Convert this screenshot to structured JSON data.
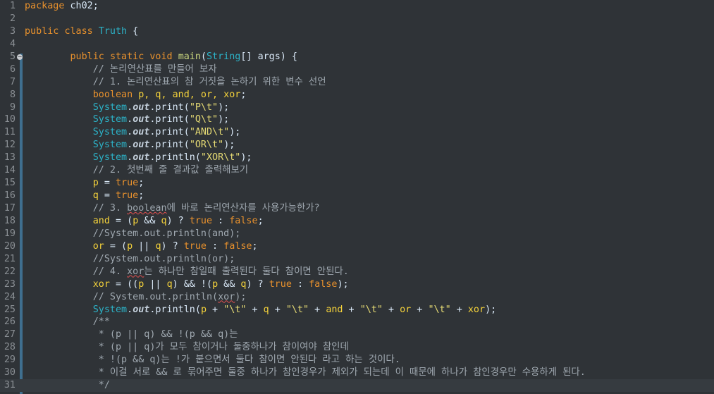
{
  "editor": {
    "lines": [
      {
        "n": "1",
        "segs": [
          [
            "kw",
            "package"
          ],
          [
            "t",
            " ch02;"
          ]
        ]
      },
      {
        "n": "2",
        "segs": []
      },
      {
        "n": "3",
        "segs": [
          [
            "kw",
            "public"
          ],
          [
            "t",
            " "
          ],
          [
            "kw",
            "class"
          ],
          [
            "t",
            " "
          ],
          [
            "cls",
            "Truth"
          ],
          [
            "t",
            " {"
          ]
        ]
      },
      {
        "n": "4",
        "segs": []
      },
      {
        "n": "5",
        "fold": "−",
        "segs": [
          [
            "t",
            "        "
          ],
          [
            "kw",
            "public"
          ],
          [
            "t",
            " "
          ],
          [
            "kw",
            "static"
          ],
          [
            "t",
            " "
          ],
          [
            "kw",
            "void"
          ],
          [
            "t",
            " "
          ],
          [
            "mname",
            "main"
          ],
          [
            "t",
            "("
          ],
          [
            "cls",
            "String"
          ],
          [
            "t",
            "[] "
          ],
          [
            "t",
            "args) {"
          ]
        ]
      },
      {
        "n": "6",
        "segs": [
          [
            "cm",
            "            // 논리연산표를 만들어 보자"
          ]
        ]
      },
      {
        "n": "7",
        "segs": [
          [
            "cm",
            "            // 1. 논리연산표의 참 거짓을 논하기 위한 변수 선언"
          ]
        ]
      },
      {
        "n": "8",
        "segs": [
          [
            "t",
            "            "
          ],
          [
            "kw",
            "boolean"
          ],
          [
            "var",
            " p, q, and, or, xor"
          ],
          [
            "t",
            ";"
          ]
        ]
      },
      {
        "n": "9",
        "segs": [
          [
            "t",
            "            "
          ],
          [
            "cls",
            "System"
          ],
          [
            "t",
            "."
          ],
          [
            "sfld",
            "out"
          ],
          [
            "t",
            ".print("
          ],
          [
            "str",
            "\"P\\t\""
          ],
          [
            "t",
            ");"
          ]
        ]
      },
      {
        "n": "10",
        "segs": [
          [
            "t",
            "            "
          ],
          [
            "cls",
            "System"
          ],
          [
            "t",
            "."
          ],
          [
            "sfld",
            "out"
          ],
          [
            "t",
            ".print("
          ],
          [
            "str",
            "\"Q\\t\""
          ],
          [
            "t",
            ");"
          ]
        ]
      },
      {
        "n": "11",
        "segs": [
          [
            "t",
            "            "
          ],
          [
            "cls",
            "System"
          ],
          [
            "t",
            "."
          ],
          [
            "sfld",
            "out"
          ],
          [
            "t",
            ".print("
          ],
          [
            "str",
            "\"AND\\t\""
          ],
          [
            "t",
            ");"
          ]
        ]
      },
      {
        "n": "12",
        "segs": [
          [
            "t",
            "            "
          ],
          [
            "cls",
            "System"
          ],
          [
            "t",
            "."
          ],
          [
            "sfld",
            "out"
          ],
          [
            "t",
            ".print("
          ],
          [
            "str",
            "\"OR\\t\""
          ],
          [
            "t",
            ");"
          ]
        ]
      },
      {
        "n": "13",
        "segs": [
          [
            "t",
            "            "
          ],
          [
            "cls",
            "System"
          ],
          [
            "t",
            "."
          ],
          [
            "sfld",
            "out"
          ],
          [
            "t",
            ".println("
          ],
          [
            "str",
            "\"XOR\\t\""
          ],
          [
            "t",
            ");"
          ]
        ]
      },
      {
        "n": "14",
        "segs": [
          [
            "cm",
            "            // 2. 첫번째 줄 결과값 출력해보기"
          ]
        ]
      },
      {
        "n": "15",
        "segs": [
          [
            "t",
            "            "
          ],
          [
            "var",
            "p"
          ],
          [
            "t",
            " = "
          ],
          [
            "kw",
            "true"
          ],
          [
            "t",
            ";"
          ]
        ]
      },
      {
        "n": "16",
        "segs": [
          [
            "t",
            "            "
          ],
          [
            "var",
            "q"
          ],
          [
            "t",
            " = "
          ],
          [
            "kw",
            "true"
          ],
          [
            "t",
            ";"
          ]
        ]
      },
      {
        "n": "17",
        "segs": [
          [
            "cm",
            "            // 3. "
          ],
          [
            "cmsq",
            "boolean"
          ],
          [
            "cm",
            "에 바로 논리연산자를 사용가능한가?"
          ]
        ]
      },
      {
        "n": "18",
        "segs": [
          [
            "t",
            "            "
          ],
          [
            "var",
            "and"
          ],
          [
            "t",
            " = ("
          ],
          [
            "var",
            "p"
          ],
          [
            "t",
            " && "
          ],
          [
            "var",
            "q"
          ],
          [
            "t",
            ") ? "
          ],
          [
            "kw",
            "true"
          ],
          [
            "t",
            " : "
          ],
          [
            "kw",
            "false"
          ],
          [
            "t",
            ";"
          ]
        ]
      },
      {
        "n": "19",
        "segs": [
          [
            "cm",
            "            //System.out.println(and);"
          ]
        ]
      },
      {
        "n": "20",
        "segs": [
          [
            "t",
            "            "
          ],
          [
            "var",
            "or"
          ],
          [
            "t",
            " = ("
          ],
          [
            "var",
            "p"
          ],
          [
            "t",
            " || "
          ],
          [
            "var",
            "q"
          ],
          [
            "t",
            ") ? "
          ],
          [
            "kw",
            "true"
          ],
          [
            "t",
            " : "
          ],
          [
            "kw",
            "false"
          ],
          [
            "t",
            ";"
          ]
        ]
      },
      {
        "n": "21",
        "segs": [
          [
            "cm",
            "            //System.out.println(or);"
          ]
        ]
      },
      {
        "n": "22",
        "segs": [
          [
            "cm",
            "            // 4. "
          ],
          [
            "cmsq",
            "xor"
          ],
          [
            "cm",
            "는 하나만 참일때 출력된다 둘다 참이면 안된다."
          ]
        ]
      },
      {
        "n": "23",
        "segs": [
          [
            "t",
            "            "
          ],
          [
            "var",
            "xor"
          ],
          [
            "t",
            " = (("
          ],
          [
            "var",
            "p"
          ],
          [
            "t",
            " || "
          ],
          [
            "var",
            "q"
          ],
          [
            "t",
            ") && !("
          ],
          [
            "var",
            "p"
          ],
          [
            "t",
            " && "
          ],
          [
            "var",
            "q"
          ],
          [
            "t",
            ") ? "
          ],
          [
            "kw",
            "true"
          ],
          [
            "t",
            " : "
          ],
          [
            "kw",
            "false"
          ],
          [
            "t",
            ");"
          ]
        ]
      },
      {
        "n": "24",
        "segs": [
          [
            "cm",
            "            // System.out.println("
          ],
          [
            "cmsq",
            "xor"
          ],
          [
            "cm",
            ");"
          ]
        ]
      },
      {
        "n": "25",
        "segs": [
          [
            "t",
            "            "
          ],
          [
            "cls",
            "System"
          ],
          [
            "t",
            "."
          ],
          [
            "sfld",
            "out"
          ],
          [
            "t",
            ".println("
          ],
          [
            "var",
            "p"
          ],
          [
            "t",
            " + "
          ],
          [
            "str",
            "\"\\t\""
          ],
          [
            "t",
            " + "
          ],
          [
            "var",
            "q"
          ],
          [
            "t",
            " + "
          ],
          [
            "str",
            "\"\\t\""
          ],
          [
            "t",
            " + "
          ],
          [
            "var",
            "and"
          ],
          [
            "t",
            " + "
          ],
          [
            "str",
            "\"\\t\""
          ],
          [
            "t",
            " + "
          ],
          [
            "var",
            "or"
          ],
          [
            "t",
            " + "
          ],
          [
            "str",
            "\"\\t\""
          ],
          [
            "t",
            " + "
          ],
          [
            "var",
            "xor"
          ],
          [
            "t",
            ");"
          ]
        ]
      },
      {
        "n": "26",
        "segs": [
          [
            "cm",
            "            /**"
          ]
        ]
      },
      {
        "n": "27",
        "segs": [
          [
            "cm",
            "             * (p || q) && !(p && q)는"
          ]
        ]
      },
      {
        "n": "28",
        "segs": [
          [
            "cm",
            "             * (p || q)가 모두 참이거나 둘중하나가 참이여야 참인데"
          ]
        ]
      },
      {
        "n": "29",
        "segs": [
          [
            "cm",
            "             * !(p && q)는 !가 붙으면서 둘다 참이면 안된다 라고 하는 것이다."
          ]
        ]
      },
      {
        "n": "30",
        "segs": [
          [
            "cm",
            "             * 이걸 서로 && 로 묶어주면 둘중 하나가 참인경우가 제외가 되는데 이 때문에 하나가 참인경우만 수용하게 된다."
          ]
        ]
      },
      {
        "n": "31",
        "current": true,
        "segs": [
          [
            "cm",
            "             */"
          ]
        ]
      }
    ]
  }
}
